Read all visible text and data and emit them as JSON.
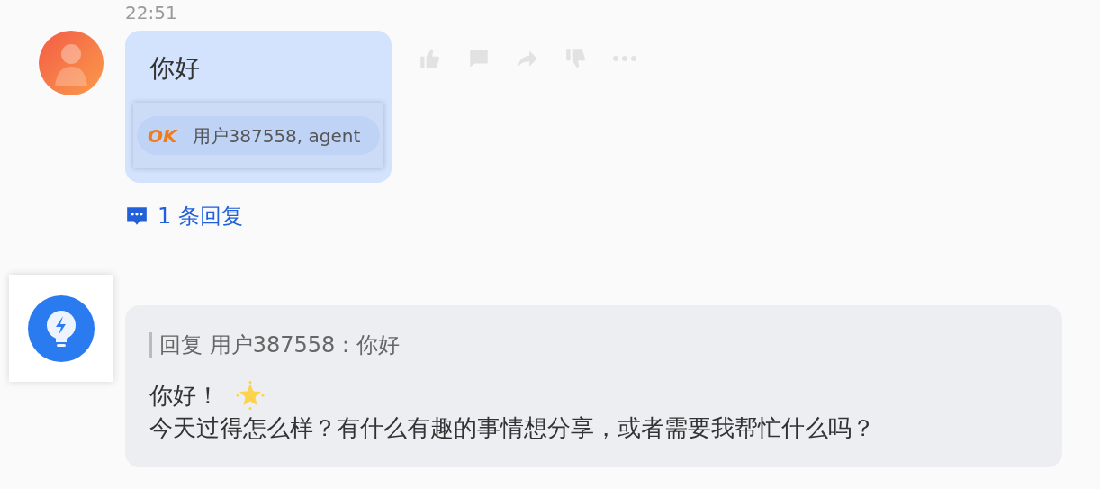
{
  "messages": [
    {
      "kind": "user",
      "time": "22:51",
      "text": "你好",
      "quote": {
        "tag": "OK",
        "text": "用户387558, agent"
      },
      "replies": "1 条回复"
    },
    {
      "kind": "bot",
      "reply_to": "回复 用户387558：你好",
      "lines": [
        "你好！",
        "今天过得怎么样？有什么有趣的事情想分享，或者需要我帮忙什么吗？"
      ]
    }
  ]
}
